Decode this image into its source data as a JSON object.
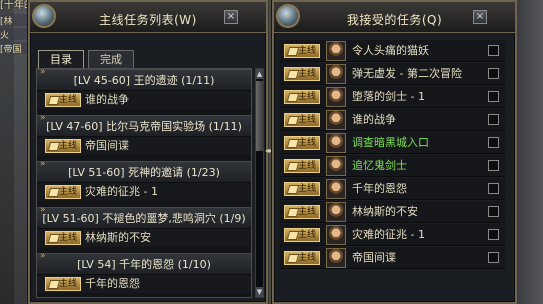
{
  "background": {
    "top_text": "[十年的恩怨]任务",
    "side_items": [
      "[林",
      "火",
      "[帝国"
    ]
  },
  "left_window": {
    "title": "主线任务列表(W)",
    "close_label": "×",
    "tabs": [
      {
        "label": "目录",
        "active": true
      },
      {
        "label": "完成",
        "active": false
      }
    ],
    "groups": [
      {
        "header": "[LV 45-60] 王的遗迹 (1/11)",
        "sub": "谁的战争"
      },
      {
        "header": "[LV 47-60] 比尔马克帝国实验场 (1/11)",
        "sub": "帝国间谍"
      },
      {
        "header": "[LV 51-60] 死神的邀请 (1/23)",
        "sub": "灾难的征兆 - 1"
      },
      {
        "header": "[LV 51-60] 不褪色的噩梦,悲鸣洞穴 (1/9)",
        "sub": "林纳斯的不安"
      },
      {
        "header": "[LV 54] 千年的恩怨 (1/10)",
        "sub": "千年的恩怨"
      }
    ],
    "badge_label": "主线",
    "scroll_up": "▲",
    "scroll_down": "▼"
  },
  "right_window": {
    "title": "我接受的任务(Q)",
    "close_label": "×",
    "badge_label": "主线",
    "tasks": [
      {
        "name": "令人头痛的猫妖",
        "green": false
      },
      {
        "name": "弹无虚发 - 第二次冒险",
        "green": false
      },
      {
        "name": "堕落的剑士 - 1",
        "green": false
      },
      {
        "name": "谁的战争",
        "green": false
      },
      {
        "name": "调查暗黑城入口",
        "green": true
      },
      {
        "name": "追忆鬼剑士",
        "green": true
      },
      {
        "name": "千年的恩怨",
        "green": false
      },
      {
        "name": "林纳斯的不安",
        "green": false
      },
      {
        "name": "灾难的征兆 - 1",
        "green": false
      },
      {
        "name": "帝国间谍",
        "green": false
      }
    ]
  },
  "divider_arrow": "◂▸",
  "colors": {
    "green_text": "#7ee05a",
    "badge_gold": "#d6b060"
  }
}
